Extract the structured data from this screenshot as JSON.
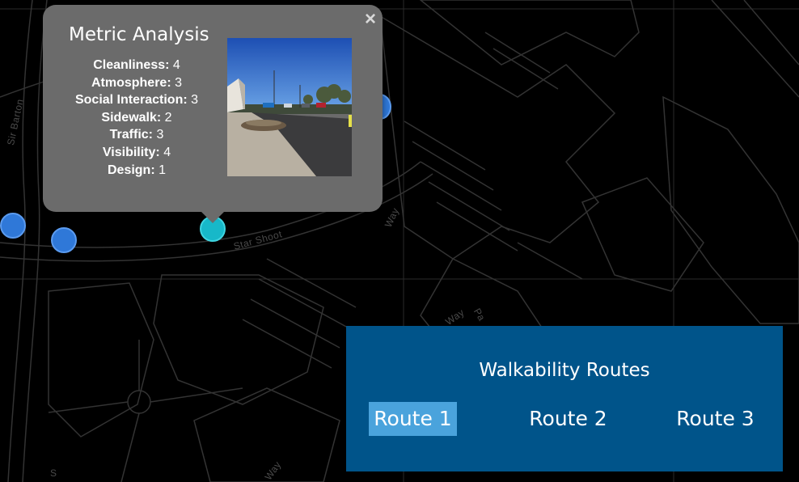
{
  "map": {
    "street_labels": [
      "Sir Barton",
      "Star Shoot",
      "Way",
      "Way",
      "Way",
      "Pa",
      "S"
    ],
    "markers": [
      {
        "kind": "point",
        "active": false
      },
      {
        "kind": "point",
        "active": false
      },
      {
        "kind": "point",
        "active": true
      },
      {
        "kind": "point",
        "active": false
      }
    ]
  },
  "popup": {
    "title": "Metric Analysis",
    "close_symbol": "×",
    "metrics": [
      {
        "label": "Cleanliness:",
        "value": "4"
      },
      {
        "label": "Atmosphere:",
        "value": "3"
      },
      {
        "label": "Social Interaction:",
        "value": "3"
      },
      {
        "label": "Sidewalk:",
        "value": "2"
      },
      {
        "label": "Traffic:",
        "value": "3"
      },
      {
        "label": "Visibility:",
        "value": "4"
      },
      {
        "label": "Design:",
        "value": "1"
      }
    ]
  },
  "routes_panel": {
    "title": "Walkability Routes",
    "routes": [
      {
        "label": "Route 1",
        "selected": true
      },
      {
        "label": "Route 2",
        "selected": false
      },
      {
        "label": "Route 3",
        "selected": false
      }
    ]
  },
  "colors": {
    "map_background": "#000000",
    "road_outline": "#3a3a3a",
    "marker_blue": "#2f78d8",
    "marker_active": "#17b8c9",
    "popup_bg": "#6b6b6b",
    "panel_bg": "#00548a",
    "route_selected_bg": "#4aa3dc"
  }
}
